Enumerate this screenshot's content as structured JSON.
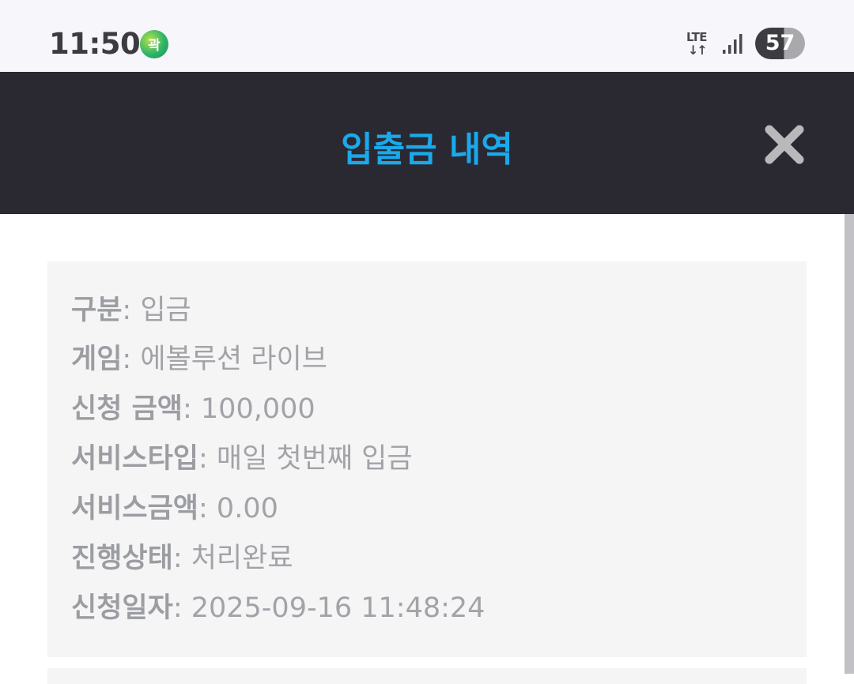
{
  "status_bar": {
    "time": "11:50",
    "app_badge_glyph": "곽",
    "network": "LTE",
    "network_arrows": "↓↑",
    "battery": "57"
  },
  "header": {
    "title": "입출금 내역",
    "close_icon": "close-icon"
  },
  "details": [
    {
      "label": "구분",
      "value": ": 입금"
    },
    {
      "label": "게임",
      "value": ": 에볼루션 라이브"
    },
    {
      "label": "신청 금액",
      "value": ": 100,000"
    },
    {
      "label": "서비스타입",
      "value": ": 매일 첫번째 입금"
    },
    {
      "label": "서비스금액",
      "value": ": 0.00"
    },
    {
      "label": "진행상태",
      "value": ": 처리완료"
    },
    {
      "label": "신청일자",
      "value": ": 2025-09-16 11:48:24"
    }
  ],
  "colors": {
    "header_bg": "#2a2932",
    "title": "#1aa9ec",
    "card_bg": "#f5f5f6",
    "text": "#a2a3a8"
  }
}
